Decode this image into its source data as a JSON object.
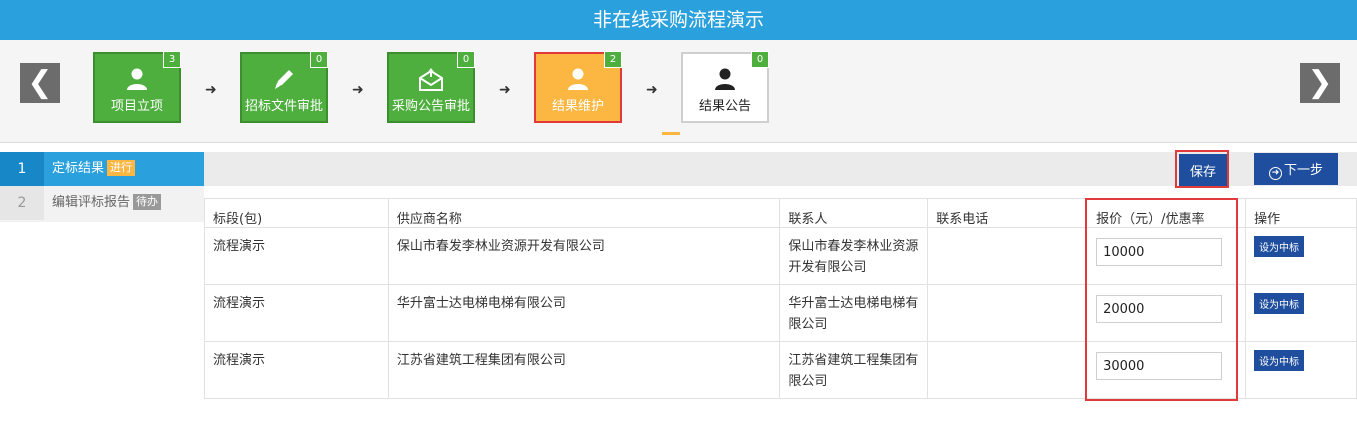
{
  "window": {
    "title": "非在线采购流程演示"
  },
  "colors": {
    "header": "#2aa0dc",
    "step_done": "#4eaf3e",
    "step_current": "#fcb743",
    "primary_button": "#1f4e9e",
    "highlight": "#e23a3a"
  },
  "steps": [
    {
      "label": "项目立项",
      "count": "3",
      "icon": "user-icon",
      "state": "done"
    },
    {
      "label": "招标文件审批",
      "count": "0",
      "icon": "pencil-icon",
      "state": "done"
    },
    {
      "label": "采购公告审批",
      "count": "0",
      "icon": "mail-icon",
      "state": "done"
    },
    {
      "label": "结果维护",
      "count": "2",
      "icon": "user-icon",
      "state": "current"
    },
    {
      "label": "结果公告",
      "count": "0",
      "icon": "user-icon",
      "state": "idle"
    }
  ],
  "nav": {
    "prev": "❮",
    "next": "❯",
    "arrow": "➜"
  },
  "sidebar": {
    "items": [
      {
        "num": "1",
        "label": "定标结果",
        "tag": "进行"
      },
      {
        "num": "2",
        "label": "编辑评标报告",
        "tag": "待办"
      }
    ]
  },
  "toolbar": {
    "save_label": "保存",
    "next_label": "下一步"
  },
  "table": {
    "headers": [
      "标段(包)",
      "供应商名称",
      "联系人",
      "联系电话",
      "报价（元）/优惠率",
      "操作"
    ],
    "rows": [
      {
        "section": "流程演示",
        "supplier": "保山市春发李林业资源开发有限公司",
        "contact": "保山市春发李林业资源开发有限公司",
        "phone": "",
        "price": "10000",
        "action": "设为中标"
      },
      {
        "section": "流程演示",
        "supplier": "华升富士达电梯电梯有限公司",
        "contact": "华升富士达电梯电梯有限公司",
        "phone": "",
        "price": "20000",
        "action": "设为中标"
      },
      {
        "section": "流程演示",
        "supplier": "江苏省建筑工程集团有限公司",
        "contact": "江苏省建筑工程集团有限公司",
        "phone": "",
        "price": "30000",
        "action": "设为中标"
      }
    ]
  }
}
